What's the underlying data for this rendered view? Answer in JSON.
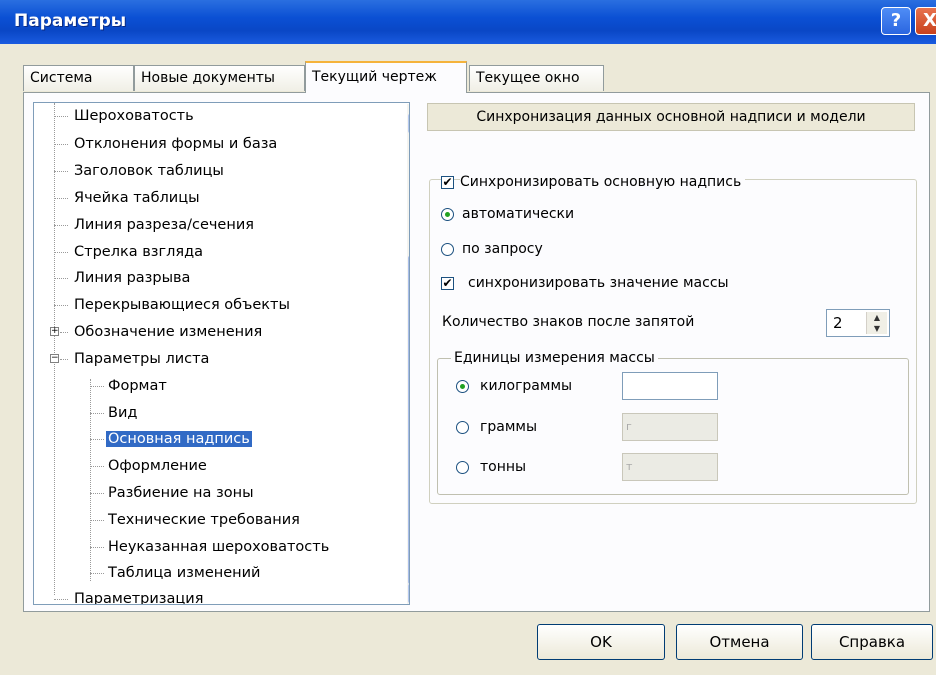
{
  "window": {
    "title": "Параметры",
    "help_glyph": "?",
    "close_glyph": "X"
  },
  "tabs": [
    {
      "label": "Система"
    },
    {
      "label": "Новые документы"
    },
    {
      "label": "Текущий чертеж",
      "active": true
    },
    {
      "label": "Текущее окно"
    }
  ],
  "tree": {
    "items": [
      {
        "label": "Шероховатость"
      },
      {
        "label": "Отклонения формы и база"
      },
      {
        "label": "Заголовок таблицы"
      },
      {
        "label": "Ячейка таблицы"
      },
      {
        "label": "Линия разреза/сечения"
      },
      {
        "label": "Стрелка взгляда"
      },
      {
        "label": "Линия разрыва"
      },
      {
        "label": "Перекрывающиеся объекты"
      },
      {
        "label": "Обозначение изменения",
        "expander": "+"
      },
      {
        "label": "Параметры листа",
        "expander": "−"
      },
      {
        "label": "Формат"
      },
      {
        "label": "Вид"
      },
      {
        "label": "Основная надпись",
        "selected": true
      },
      {
        "label": "Оформление"
      },
      {
        "label": "Разбиение на зоны"
      },
      {
        "label": "Технические требования"
      },
      {
        "label": "Неуказанная шероховатость"
      },
      {
        "label": "Таблица изменений"
      },
      {
        "label": "Параметризация"
      }
    ]
  },
  "settings": {
    "section_title": "Синхронизация данных основной надписи и модели",
    "sync_title_block": {
      "label": "Синхронизировать основную надпись",
      "checked": true
    },
    "mode_auto": {
      "label": "автоматически",
      "selected": true
    },
    "mode_on_request": {
      "label": "по запросу",
      "selected": false
    },
    "sync_mass": {
      "label": "синхронизировать значение массы",
      "checked": true
    },
    "decimals": {
      "label": "Количество знаков после запятой",
      "value": "2"
    },
    "mass_units": {
      "title": "Единицы измерения массы",
      "kilograms": {
        "label": "килограммы",
        "selected": true,
        "value": ""
      },
      "grams": {
        "label": "граммы",
        "selected": false,
        "placeholder": "г"
      },
      "tonnes": {
        "label": "тонны",
        "selected": false,
        "placeholder": "т"
      }
    }
  },
  "buttons": {
    "ok": "OK",
    "cancel": "Отмена",
    "help": "Справка"
  },
  "colors": {
    "titlebar": "#0b50d4",
    "selection": "#316ac5",
    "dialog_bg": "#ece9d8"
  }
}
